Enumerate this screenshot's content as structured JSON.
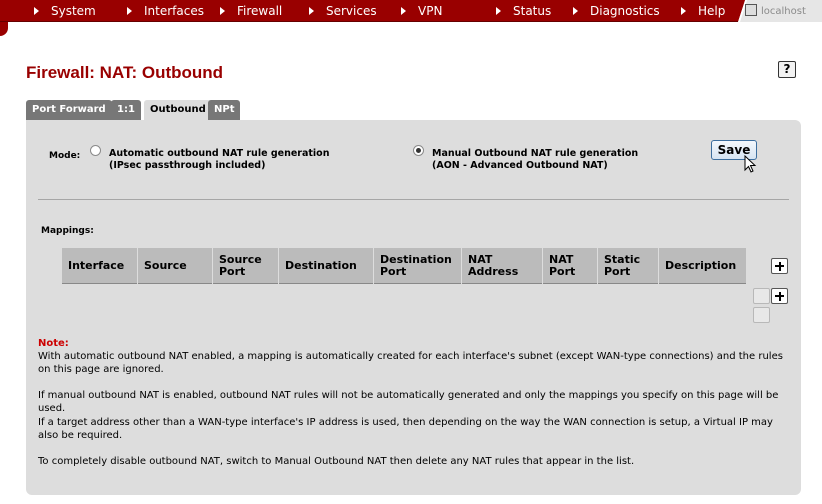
{
  "nav": {
    "items": [
      {
        "label": "System"
      },
      {
        "label": "Interfaces"
      },
      {
        "label": "Firewall"
      },
      {
        "label": "Services"
      },
      {
        "label": "VPN"
      },
      {
        "label": "Status"
      },
      {
        "label": "Diagnostics"
      },
      {
        "label": "Help"
      }
    ],
    "host_label": "localhost"
  },
  "page": {
    "title": "Firewall: NAT: Outbound",
    "help_label": "?"
  },
  "tabs": [
    {
      "label": "Port Forward",
      "active": false
    },
    {
      "label": "1:1",
      "active": false
    },
    {
      "label": "Outbound",
      "active": true
    },
    {
      "label": "NPt",
      "active": false
    }
  ],
  "mode": {
    "label": "Mode:",
    "options": [
      {
        "line1": "Automatic outbound NAT rule generation",
        "line2": "(IPsec passthrough included)",
        "checked": false
      },
      {
        "line1": "Manual Outbound NAT rule generation",
        "line2": "(AON - Advanced Outbound NAT)",
        "checked": true
      }
    ],
    "save_label": "Save"
  },
  "mappings": {
    "label": "Mappings:",
    "columns": [
      "Interface",
      "Source",
      "Source\nPort",
      "Destination",
      "Destination\nPort",
      "NAT\nAddress",
      "NAT\nPort",
      "Static\nPort",
      "Description"
    ]
  },
  "notes": {
    "title": "Note:",
    "paragraphs": [
      "With automatic outbound NAT enabled, a mapping is automatically created for each interface's subnet (except WAN-type connections) and the rules on this page are ignored.",
      "If manual outbound NAT is enabled, outbound NAT rules will not be automatically generated and only the mappings you specify on this page will be used.",
      "If a target address other than a WAN-type interface's IP address is used, then depending on the way the WAN connection is setup, a Virtual IP may also be required.",
      "To completely disable outbound NAT, switch to Manual Outbound NAT then delete any NAT rules that appear in the list."
    ]
  },
  "colors": {
    "brand": "#990000",
    "panel": "#dddddd",
    "table_header": "#bbbbbb",
    "note_title": "#cc0000"
  }
}
